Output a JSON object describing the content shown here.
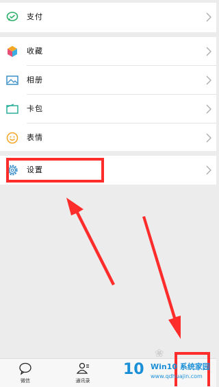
{
  "menu": {
    "pay": {
      "label": "支付",
      "icon": "wechat-pay-icon"
    },
    "favorites": {
      "label": "收藏",
      "icon": "cube-icon"
    },
    "album": {
      "label": "相册",
      "icon": "picture-icon"
    },
    "cards": {
      "label": "卡包",
      "icon": "wallet-icon"
    },
    "stickers": {
      "label": "表情",
      "icon": "smiley-icon"
    },
    "settings": {
      "label": "设置",
      "icon": "gear-icon"
    }
  },
  "tabbar": {
    "chats": {
      "label": "微信",
      "icon": "chat-bubble-icon"
    },
    "contacts": {
      "label": "通讯录",
      "icon": "contacts-icon"
    }
  },
  "watermark": {
    "number": "10",
    "title": "Win10 系统家园",
    "url": "www.qdhuajin.com"
  },
  "colors": {
    "highlight": "#ff2c2c",
    "pay_green": "#2aae67",
    "icon_blue": "#3a8fc9",
    "watermark_blue": "#1a8fd8"
  }
}
